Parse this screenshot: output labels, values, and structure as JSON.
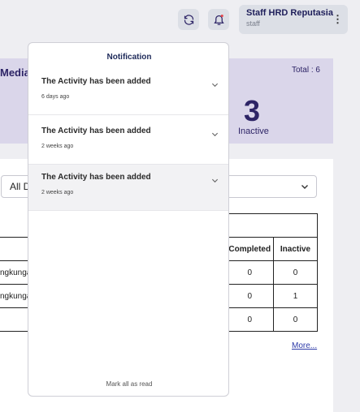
{
  "header": {
    "refresh_icon": "refresh-icon",
    "bell_icon": "bell-icon",
    "user": {
      "name": "Staff HRD Reputasia",
      "role": "staff"
    },
    "kebab": "⋮"
  },
  "stats": {
    "title": "Media",
    "total": "Total : 6",
    "inactive_value": "3",
    "inactive_label": "Inactive"
  },
  "filter": {
    "selected": "All D"
  },
  "table": {
    "headers": [
      "Completed",
      "Inactive"
    ],
    "rows": [
      {
        "name": "ngkunga",
        "completed": "0",
        "inactive": "0"
      },
      {
        "name": "ngkunga",
        "completed": "0",
        "inactive": "1"
      },
      {
        "name": "",
        "completed": "0",
        "inactive": "0"
      }
    ]
  },
  "more_link": "More...",
  "notifications": {
    "title": "Notification",
    "items": [
      {
        "text": "The Activity has been added",
        "time": "6 days ago"
      },
      {
        "text": "The Activity has been added",
        "time": "2 weeks ago"
      },
      {
        "text": "The Activity has been added",
        "time": "2 weeks ago"
      }
    ],
    "mark_all": "Mark all as read"
  }
}
